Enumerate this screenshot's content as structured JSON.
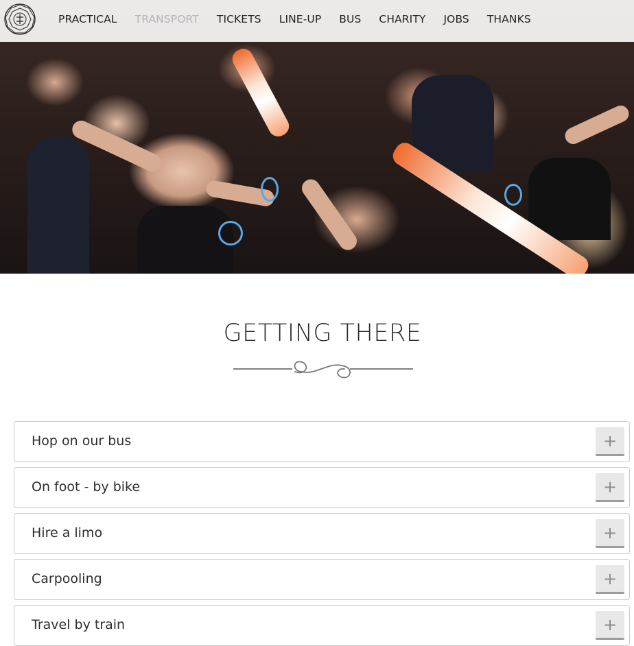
{
  "nav": {
    "logo_icon": "crest-logo-icon",
    "items": [
      {
        "label": "PRACTICAL"
      },
      {
        "label": "TRANSPORT",
        "active": true
      },
      {
        "label": "TICKETS"
      },
      {
        "label": "LINE-UP"
      },
      {
        "label": "BUS"
      },
      {
        "label": "CHARITY"
      },
      {
        "label": "JOBS"
      },
      {
        "label": "THANKS"
      }
    ],
    "active_color": "#b5b3bd"
  },
  "hero": {
    "image": "party-crowd-photo"
  },
  "section": {
    "title": "GETTING THERE",
    "divider_icon": "flourish-divider-icon"
  },
  "accordion": {
    "toggle_symbol": "+",
    "items": [
      {
        "label": "Hop on our bus"
      },
      {
        "label": "On foot - by bike"
      },
      {
        "label": "Hire a limo"
      },
      {
        "label": "Carpooling"
      },
      {
        "label": "Travel by train"
      }
    ]
  }
}
